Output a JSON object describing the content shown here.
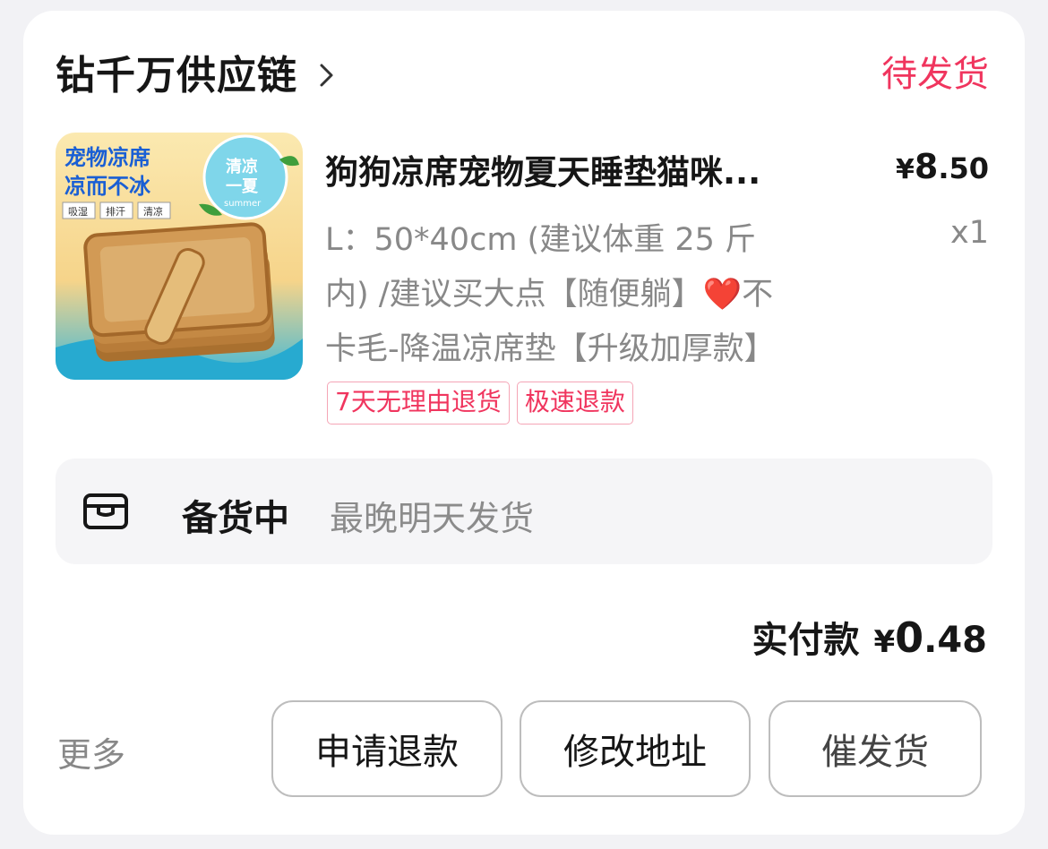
{
  "shop": {
    "name": "钻千万供应链",
    "status": "待发货"
  },
  "product": {
    "title": "狗狗凉席宠物夏天睡垫猫咪...",
    "price_symbol": "¥",
    "price_int": "8",
    "price_dec": ".50",
    "spec_lines": [
      "L：50*40cm (建议体重 25 斤",
      "内) /建议买大点【随便躺】",
      "不",
      "卡毛-降温凉席垫【升级加厚款】"
    ],
    "heart": "❤️",
    "quantity": "x1",
    "tags": [
      "7天无理由退货",
      "极速退款"
    ],
    "image_text": {
      "line1": "宠物凉席",
      "line2": "凉而不冰",
      "badge1": "吸湿",
      "badge2": "排汗",
      "badge3": "清凉",
      "circle_line1": "清凉",
      "circle_line2": "一夏",
      "circle_line3": "summer"
    }
  },
  "shipping": {
    "status": "备货中",
    "note": "最晚明天发货"
  },
  "payment": {
    "label": "实付款",
    "symbol": "¥",
    "int": "0",
    "dec": ".48"
  },
  "actions": {
    "more": "更多",
    "refund": "申请退款",
    "edit_address": "修改地址",
    "third": "催发货"
  },
  "colors": {
    "accent": "#f0355e",
    "tag_border": "#f5a5b6",
    "muted": "#888888"
  }
}
